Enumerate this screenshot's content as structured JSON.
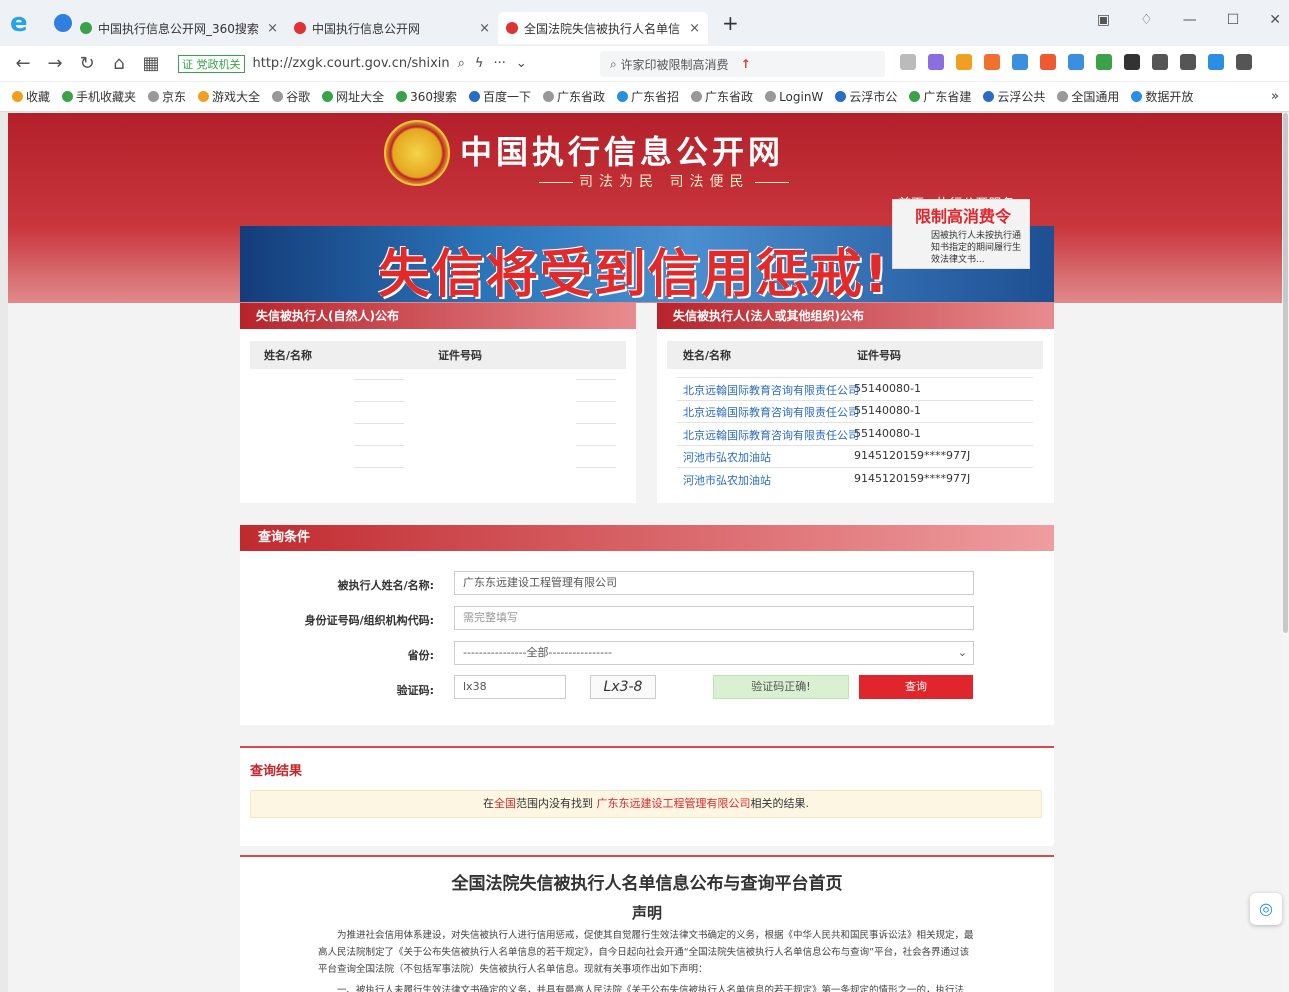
{
  "browser": {
    "tabs": [
      {
        "label": "中国执行信息公开网_360搜索",
        "active": false
      },
      {
        "label": "中国执行信息公开网",
        "active": false
      },
      {
        "label": "全国法院失信被执行人名单信",
        "active": true
      }
    ],
    "url": "http://zxgk.court.gov.cn/shixin",
    "url_tag": "证 党政机关",
    "search_text": "许家印被限制高消费",
    "bookmarks": [
      "收藏",
      "手机收藏夹",
      "京东",
      "游戏大全",
      "谷歌",
      "网址大全",
      "360搜索",
      "百度一下",
      "广东省政",
      "广东省招",
      "广东省政",
      "LoginW",
      "云浮市公",
      "广东省建",
      "云浮公共",
      "全国通用",
      "数据开放"
    ]
  },
  "site": {
    "title": "中国执行信息公开网",
    "subtitle": "司法为民  司法便民",
    "home_link": "首页 · 执行公开服务",
    "banner_text": "失信将受到信用惩戒!",
    "order_title": "限制高消费令",
    "order_desc": "因被执行人未按执行通知书指定的期间履行生效法律文书..."
  },
  "natural_panel": {
    "title": "失信被执行人(自然人)公布",
    "col_name": "姓名/名称",
    "col_id": "证件号码"
  },
  "legal_panel": {
    "title": "失信被执行人(法人或其他组织)公布",
    "col_name": "姓名/名称",
    "col_id": "证件号码",
    "rows": [
      {
        "name": "北京远翰国际教育咨询有限责任公司",
        "id": "55140080-1"
      },
      {
        "name": "北京远翰国际教育咨询有限责任公司",
        "id": "55140080-1"
      },
      {
        "name": "北京远翰国际教育咨询有限责任公司",
        "id": "55140080-1"
      },
      {
        "name": "河池市弘农加油站",
        "id": "9145120159****977J"
      },
      {
        "name": "河池市弘农加油站",
        "id": "9145120159****977J"
      }
    ]
  },
  "query": {
    "title": "查询条件",
    "name_label": "被执行人姓名/名称:",
    "name_value": "广东东远建设工程管理有限公司",
    "id_label": "身份证号码/组织机构代码:",
    "id_placeholder": "需完整填写",
    "province_label": "省份:",
    "province_value": "----------------全部----------------",
    "captcha_label": "验证码:",
    "captcha_value": "lx38",
    "captcha_image_text": "Lx3-8",
    "captcha_ok": "验证码正确!",
    "submit": "查询"
  },
  "result": {
    "title": "查询结果",
    "prefix": "在",
    "scope": "全国",
    "middle": "范围内没有找到 ",
    "company": "广东东远建设工程管理有限公司",
    "suffix": "相关的结果."
  },
  "declaration": {
    "title": "全国法院失信被执行人名单信息公布与查询平台首页",
    "subtitle": "声明",
    "p1": "为推进社会信用体系建设，对失信被执行人进行信用惩戒，促使其自觉履行生效法律文书确定的义务，根据《中华人民共和国民事诉讼法》相关规定，最高人民法院制定了《关于公布失信被执行人名单信息的若干规定》，自今日起向社会开通“全国法院失信被执行人名单信息公布与查询”平台，社会各界通过该平台查询全国法院（不包括军事法院）失信被执行人名单信息。现就有关事项作出如下声明：",
    "p2": "一、被执行人未履行生效法律文书确定的义务，并具有最高人民法院《关于公布失信被执行人名单信息的若干规定》第一条规定的情形之一的，执行法"
  }
}
